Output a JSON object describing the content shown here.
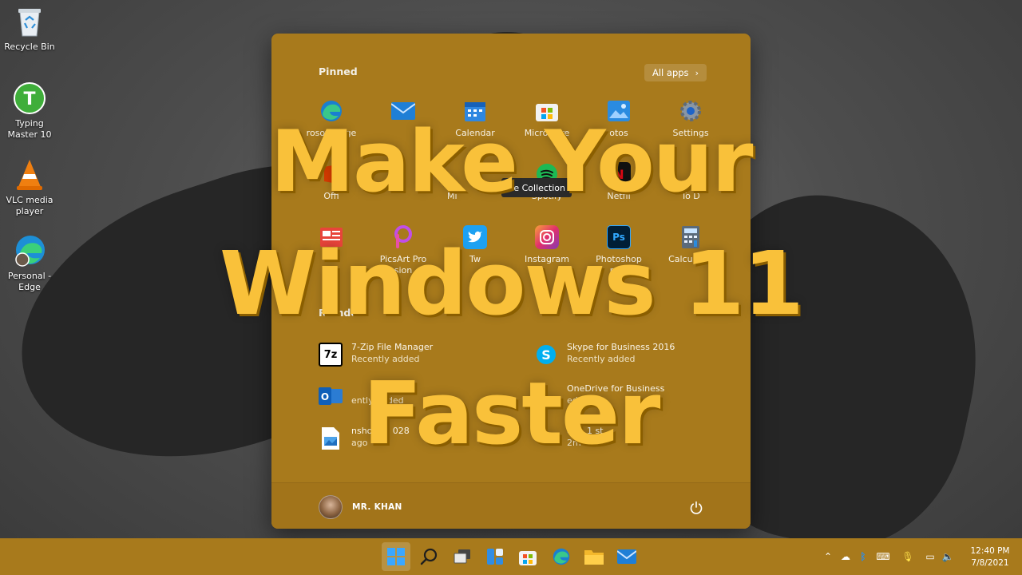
{
  "desktop": {
    "icons": [
      {
        "label": "Recycle Bin",
        "icon": "recycle-bin-icon"
      },
      {
        "label": "Typing Master 10",
        "icon": "typing-master-icon"
      },
      {
        "label": "VLC media player",
        "icon": "vlc-icon"
      },
      {
        "label": "Personal - Edge",
        "icon": "edge-profile-icon"
      }
    ]
  },
  "start_menu": {
    "pinned_title": "Pinned",
    "all_apps_label": "All apps",
    "pinned": [
      {
        "label": "rosoft Edge",
        "icon": "edge-icon"
      },
      {
        "label": "",
        "icon": "mail-icon"
      },
      {
        "label": "Calendar",
        "icon": "calendar-icon"
      },
      {
        "label": "Microso        re",
        "icon": "store-icon"
      },
      {
        "label": "otos",
        "icon": "photos-icon"
      },
      {
        "label": "Settings",
        "icon": "settings-icon"
      },
      {
        "label": "Offi",
        "icon": "office-icon"
      },
      {
        "label": "Mi",
        "icon": "solitaire-icon"
      },
      {
        "label": "Spotify",
        "icon": "spotify-icon"
      },
      {
        "label": "Netfli",
        "icon": "netflix-icon"
      },
      {
        "label": "To D",
        "icon": "todo-icon"
      },
      {
        "label": "N",
        "icon": "news-icon"
      },
      {
        "label": "PicsArt Pro",
        "label2": "sion",
        "icon": "picsart-icon"
      },
      {
        "label": "Tw",
        "icon": "twitter-icon"
      },
      {
        "label": "Instagram",
        "icon": "instagram-icon"
      },
      {
        "label": "Photoshop",
        "label2": "ress",
        "icon": "photoshop-icon"
      },
      {
        "label": "Calculator",
        "icon": "calculator-icon"
      }
    ],
    "tooltip": "ire Collection",
    "recommended_title": "Re        nded",
    "recommended": [
      {
        "title": "7-Zip File Manager",
        "subtitle": "Recently added",
        "icon": "7zip-icon"
      },
      {
        "title": "Skype for Business 2016",
        "subtitle": "Recently added",
        "icon": "skype-icon"
      },
      {
        "title": "",
        "subtitle": "ently added",
        "icon": "outlook-icon"
      },
      {
        "title": "OneDrive for Business",
        "subtitle": "ed",
        "icon": "onedrive-icon"
      },
      {
        "title": "nshot 20       028",
        "subtitle": "ago",
        "icon": "image-file-icon"
      },
      {
        "title": "ows 1 st",
        "subtitle": "2m",
        "icon": "file-icon"
      }
    ],
    "user_name": "MR. KHAN"
  },
  "headline": {
    "line1": "Make Your",
    "line2": "Windows 11",
    "line3": "Faster"
  },
  "taskbar": {
    "apps": [
      "start-icon",
      "search-icon",
      "task-view-icon",
      "widgets-icon",
      "store-icon",
      "edge-icon",
      "file-explorer-icon",
      "mail-icon"
    ],
    "time": "12:40 PM",
    "date": "7/8/2021"
  },
  "colors": {
    "overlay_gold": "#a87a1c",
    "headline": "#f9c13a"
  }
}
